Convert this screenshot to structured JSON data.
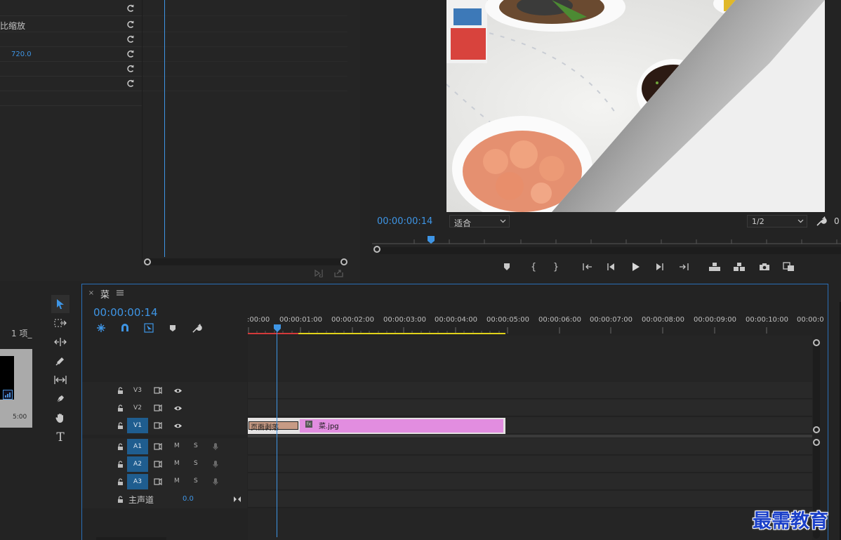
{
  "effects": {
    "rows": [
      {
        "label": "",
        "value": ""
      },
      {
        "label": "比缩放",
        "value": ""
      },
      {
        "label": "",
        "value": ""
      },
      {
        "label": "",
        "value": "720.0"
      },
      {
        "label": "",
        "value": ""
      },
      {
        "label": "",
        "value": ""
      }
    ]
  },
  "program": {
    "timecode": "00:00:00:14",
    "fit_label": "适合",
    "resolution_label": "1/2",
    "right_cut_text": "0"
  },
  "project": {
    "items_count": "1 项_",
    "thumb_time": "5:00"
  },
  "timeline": {
    "sequence_name": "菜",
    "timecode": "00:00:00:14",
    "ruler": [
      ":00:00",
      "00:00:01:00",
      "00:00:02:00",
      "00:00:03:00",
      "00:00:04:00",
      "00:00:05:00",
      "00:00:06:00",
      "00:00:07:00",
      "00:00:08:00",
      "00:00:09:00",
      "00:00:10:00",
      "00:00:0"
    ],
    "video_tracks": [
      "V3",
      "V2",
      "V1"
    ],
    "audio_tracks": [
      "A1",
      "A2",
      "A3"
    ],
    "mute_label": "M",
    "solo_label": "S",
    "master": {
      "label": "主声道",
      "value": "0.0"
    },
    "clips": {
      "transition_label": "页面剥落",
      "fx_badge": "fx",
      "clip_name": "菜.jpg"
    }
  },
  "watermark": "最需教育",
  "colors": {
    "accent_blue": "#3e95e5",
    "clip_pink": "#e28de0",
    "transition_tan": "#c79b85",
    "work_yellow": "#e0d21a",
    "work_red": "#d33a3a",
    "watermark_blue": "#1a3fc8"
  }
}
